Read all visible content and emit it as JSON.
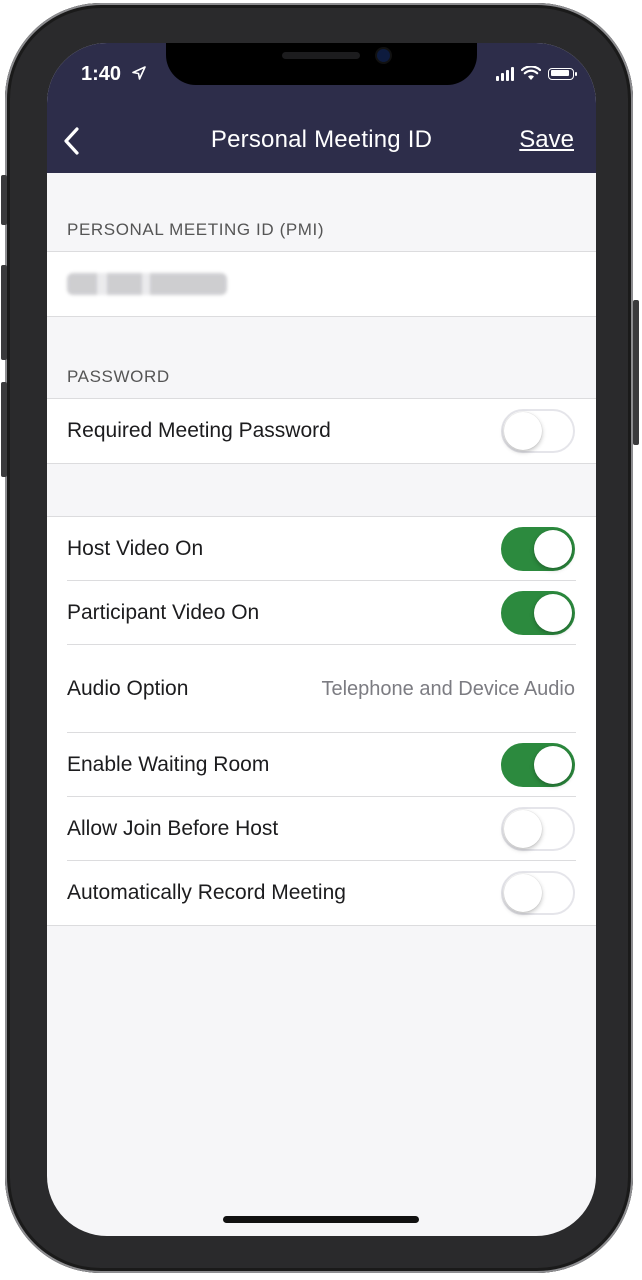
{
  "status_bar": {
    "time": "1:40"
  },
  "nav": {
    "title": "Personal Meeting ID",
    "save_label": "Save"
  },
  "pmi_section": {
    "label": "PERSONAL MEETING ID (PMI)"
  },
  "password_section": {
    "label": "PASSWORD",
    "required_password": {
      "label": "Required Meeting Password",
      "on": false
    }
  },
  "settings": {
    "host_video": {
      "label": "Host Video On",
      "on": true
    },
    "participant_video": {
      "label": "Participant Video On",
      "on": true
    },
    "audio_option": {
      "label": "Audio Option",
      "value": "Telephone and Device Audio"
    },
    "waiting_room": {
      "label": "Enable Waiting Room",
      "on": true
    },
    "join_before_host": {
      "label": "Allow Join Before Host",
      "on": false
    },
    "auto_record": {
      "label": "Automatically Record Meeting",
      "on": false
    }
  },
  "colors": {
    "header_bg": "#2d2d4a",
    "toggle_on": "#2c8a3e"
  }
}
